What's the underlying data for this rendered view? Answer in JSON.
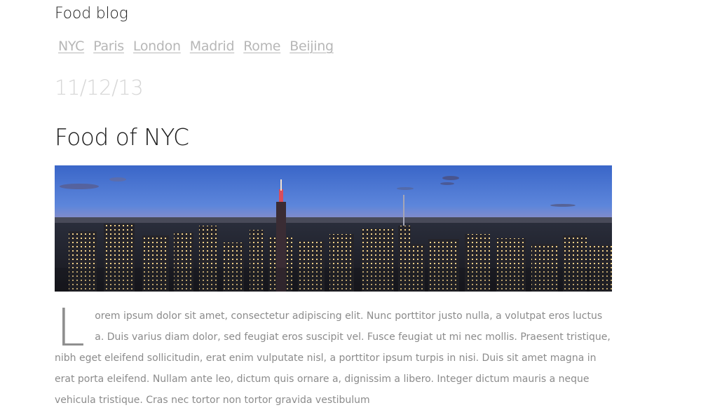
{
  "site": {
    "title": "Food blog"
  },
  "nav": {
    "links": [
      "NYC",
      "Paris",
      "London",
      "Madrid",
      "Rome",
      "Beijing"
    ]
  },
  "post": {
    "date": "11/12/13",
    "title": "Food of NYC",
    "dropcap": "L",
    "body": "orem ipsum dolor sit amet, consectetur adipiscing elit. Nunc porttitor justo nulla, a volutpat eros luctus a. Duis varius diam dolor, sed feugiat eros suscipit vel. Fusce feugiat ut mi nec mollis. Praesent tristique, nibh eget eleifend sollicitudin, erat enim vulputate nisl, a porttitor ipsum turpis in nisi. Duis sit amet magna in erat porta eleifend. Nullam ante leo, dictum quis ornare a, dignissim a libero. Integer dictum mauris a neque vehicula tristique. Cras nec tortor non tortor gravida vestibulum"
  },
  "colors": {
    "title": "#1e1e1e",
    "nav": "#b7b7b7",
    "date": "#d6d6d6",
    "body": "#8b8b8b"
  }
}
